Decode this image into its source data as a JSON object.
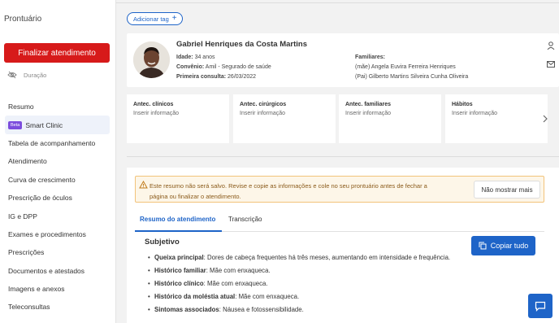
{
  "sidebar": {
    "title": "Prontuário",
    "finalize_label": "Finalizar atendimento",
    "duration_label": "Duração",
    "beta_badge": "Beta",
    "items": [
      {
        "label": "Resumo"
      },
      {
        "label": "Smart Clinic"
      },
      {
        "label": "Tabela de acompanhamento"
      },
      {
        "label": "Atendimento"
      },
      {
        "label": "Curva de crescimento"
      },
      {
        "label": "Prescrição de óculos"
      },
      {
        "label": "IG e DPP"
      },
      {
        "label": "Exames e procedimentos"
      },
      {
        "label": "Prescrições"
      },
      {
        "label": "Documentos e atestados"
      },
      {
        "label": "Imagens e anexos"
      },
      {
        "label": "Teleconsultas"
      }
    ]
  },
  "main": {
    "add_tag_label": "Adicionar tag",
    "patient": {
      "name": "Gabriel Henriques da Costa Martins",
      "age_label": "Idade:",
      "age_value": "34 anos",
      "insurance_label": "Convênio:",
      "insurance_value": "Amil - Segurado de saúde",
      "first_visit_label": "Primeira consulta:",
      "first_visit_value": "26/03/2022",
      "family_title": "Familiares:",
      "family": [
        "(mãe) Angela Euvira Ferreira Henriques",
        "(Pai) Gilberto Martins Silveira Cunha Oliveira"
      ]
    },
    "antecedents": [
      {
        "title": "Antec. clínicos",
        "placeholder": "Inserir informação"
      },
      {
        "title": "Antec. cirúrgicos",
        "placeholder": "Inserir informação"
      },
      {
        "title": "Antec. familiares",
        "placeholder": "Inserir informação"
      },
      {
        "title": "Hábitos",
        "placeholder": "Inserir informação"
      }
    ],
    "alert": {
      "text": "Este resumo não será salvo. Revise e copie as informações e cole no seu prontuário antes de fechar a página ou finalizar o atendimento.",
      "button": "Não mostrar mais"
    },
    "tabs": [
      {
        "label": "Resumo do atendimento"
      },
      {
        "label": "Transcrição"
      }
    ],
    "section_title": "Subjetivo",
    "copy_label": "Copiar tudo",
    "bullets": [
      {
        "key": "Queixa principal",
        "value": ": Dores de cabeça frequentes há três meses, aumentando em intensidade e frequência."
      },
      {
        "key": "Histórico familiar",
        "value": ": Mãe com enxaqueca."
      },
      {
        "key": "Histórico clínico",
        "value": ": Mãe com enxaqueca."
      },
      {
        "key": "Histórico da moléstia atual",
        "value": ": Mãe com enxaqueca."
      },
      {
        "key": "Sintomas associados",
        "value": ": Náusea e fotossensibilidade."
      }
    ]
  },
  "colors": {
    "primary": "#1e64c8",
    "danger": "#d71a1a",
    "beta": "#7c4ddd",
    "alert_bg": "#fdf6e8",
    "alert_border": "#f2c37a"
  }
}
